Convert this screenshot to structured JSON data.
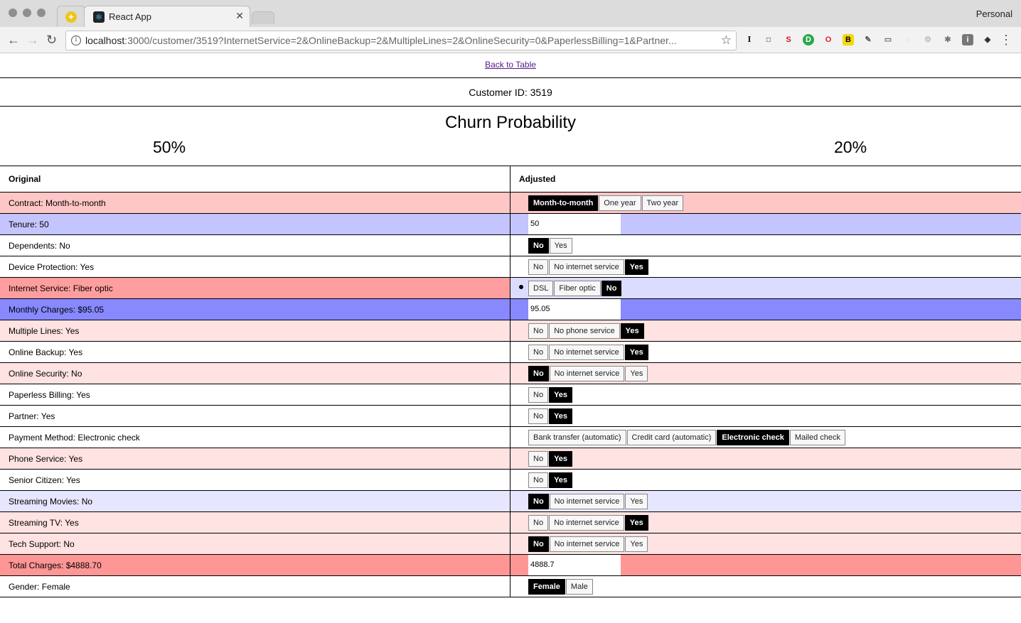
{
  "browser": {
    "tab_title": "React App",
    "profile": "Personal",
    "url_host": "localhost",
    "url_rest": ":3000/customer/3519?InternetService=2&OnlineBackup=2&MultipleLines=2&OnlineSecurity=0&PaperlessBilling=1&Partner..."
  },
  "page": {
    "back_link": "Back to Table",
    "customer_id": "Customer ID: 3519",
    "churn_title": "Churn Probability",
    "original_prob": "50%",
    "adjusted_prob": "20%",
    "col_original": "Original",
    "col_adjusted": "Adjusted"
  },
  "rows": [
    {
      "label": "Contract: Month-to-month",
      "bg": "#ffc6c6",
      "type": "seg",
      "options": [
        "Month-to-month",
        "One year",
        "Two year"
      ],
      "selected": 0
    },
    {
      "label": "Tenure: 50",
      "bg": "#c4c4ff",
      "type": "num",
      "value": "50"
    },
    {
      "label": "Dependents: No",
      "bg": "#ffffff",
      "type": "seg",
      "options": [
        "No",
        "Yes"
      ],
      "selected": 0
    },
    {
      "label": "Device Protection: Yes",
      "bg": "#ffffff",
      "type": "seg",
      "options": [
        "No",
        "No internet service",
        "Yes"
      ],
      "selected": 2
    },
    {
      "label": "Internet Service: Fiber optic",
      "bg": "#ff9e9e",
      "right_bg": "#dcdcff",
      "type": "seg",
      "bullet": true,
      "options": [
        "DSL",
        "Fiber optic",
        "No"
      ],
      "selected": 2
    },
    {
      "label": "Monthly Charges: $95.05",
      "bg": "#8888ff",
      "type": "num",
      "value": "95.05"
    },
    {
      "label": "Multiple Lines: Yes",
      "bg": "#ffe2e2",
      "type": "seg",
      "options": [
        "No",
        "No phone service",
        "Yes"
      ],
      "selected": 2
    },
    {
      "label": "Online Backup: Yes",
      "bg": "#ffffff",
      "type": "seg",
      "options": [
        "No",
        "No internet service",
        "Yes"
      ],
      "selected": 2
    },
    {
      "label": "Online Security: No",
      "bg": "#ffe2e2",
      "type": "seg",
      "options": [
        "No",
        "No internet service",
        "Yes"
      ],
      "selected": 0
    },
    {
      "label": "Paperless Billing: Yes",
      "bg": "#ffffff",
      "type": "seg",
      "options": [
        "No",
        "Yes"
      ],
      "selected": 1
    },
    {
      "label": "Partner: Yes",
      "bg": "#ffffff",
      "type": "seg",
      "options": [
        "No",
        "Yes"
      ],
      "selected": 1
    },
    {
      "label": "Payment Method: Electronic check",
      "bg": "#ffffff",
      "type": "seg",
      "options": [
        "Bank transfer (automatic)",
        "Credit card (automatic)",
        "Electronic check",
        "Mailed check"
      ],
      "selected": 2
    },
    {
      "label": "Phone Service: Yes",
      "bg": "#ffe2e2",
      "type": "seg",
      "options": [
        "No",
        "Yes"
      ],
      "selected": 1
    },
    {
      "label": "Senior Citizen: Yes",
      "bg": "#ffffff",
      "type": "seg",
      "options": [
        "No",
        "Yes"
      ],
      "selected": 1
    },
    {
      "label": "Streaming Movies: No",
      "bg": "#e6e6ff",
      "type": "seg",
      "options": [
        "No",
        "No internet service",
        "Yes"
      ],
      "selected": 0
    },
    {
      "label": "Streaming TV: Yes",
      "bg": "#ffe2e2",
      "type": "seg",
      "options": [
        "No",
        "No internet service",
        "Yes"
      ],
      "selected": 2
    },
    {
      "label": "Tech Support: No",
      "bg": "#ffe2e2",
      "type": "seg",
      "options": [
        "No",
        "No internet service",
        "Yes"
      ],
      "selected": 0
    },
    {
      "label": "Total Charges: $4888.70",
      "bg": "#ff9696",
      "type": "num",
      "value": "4888.7"
    },
    {
      "label": "Gender: Female",
      "bg": "#ffffff",
      "type": "seg",
      "options": [
        "Female",
        "Male"
      ],
      "selected": 0
    }
  ]
}
